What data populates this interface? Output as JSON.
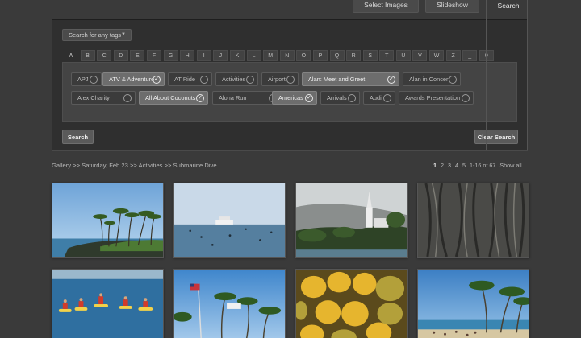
{
  "top_actions": {
    "select_images": "Select Images",
    "slideshow": "Slideshow",
    "search_tab": "Search"
  },
  "search_panel": {
    "tag_dropdown": "Search for any tags",
    "letters": [
      "A",
      "B",
      "C",
      "D",
      "E",
      "F",
      "G",
      "H",
      "I",
      "J",
      "K",
      "L",
      "M",
      "N",
      "O",
      "P",
      "Q",
      "R",
      "S",
      "T",
      "U",
      "V",
      "W",
      "Z",
      "_",
      "0"
    ],
    "active_letter": "A",
    "tags": [
      {
        "label": "APJ",
        "selected": false
      },
      {
        "label": "ATV & Adventure",
        "selected": true
      },
      {
        "label": "AT Ride",
        "selected": false
      },
      {
        "label": "Activities",
        "selected": false
      },
      {
        "label": "Airport",
        "selected": false
      },
      {
        "label": "Alan: Meet and Greet",
        "selected": true
      },
      {
        "label": "Alan in Concert",
        "selected": false
      },
      {
        "label": "Alex Charity",
        "selected": false
      },
      {
        "label": "All About Coconuts",
        "selected": true
      },
      {
        "label": "Aloha Run",
        "selected": false
      },
      {
        "label": "Americas",
        "selected": true
      },
      {
        "label": "Arrivals",
        "selected": false
      },
      {
        "label": "Audi",
        "selected": false
      },
      {
        "label": "Awards Presentation",
        "selected": false
      }
    ],
    "search_button": "Search",
    "clear_button": "Clear Search"
  },
  "breadcrumb": "Gallery >> Saturday, Feb 23 >> Activities >> Submarine Dive",
  "pagination": {
    "pages": [
      "1",
      "2",
      "3",
      "4",
      "5"
    ],
    "current": "1",
    "range": "1-16 of 67",
    "show_all": "Show all"
  },
  "thumbnails": [
    {
      "subject": "palm-trees-beach-photo"
    },
    {
      "subject": "cruise-ship-swimmers-photo"
    },
    {
      "subject": "church-steeple-coast-photo"
    },
    {
      "subject": "banyan-tree-roots-photo"
    },
    {
      "subject": "kayakers-in-bay-photo"
    },
    {
      "subject": "flag-and-palms-photo"
    },
    {
      "subject": "papaya-fruit-photo"
    },
    {
      "subject": "beach-palms-people-photo"
    }
  ]
}
